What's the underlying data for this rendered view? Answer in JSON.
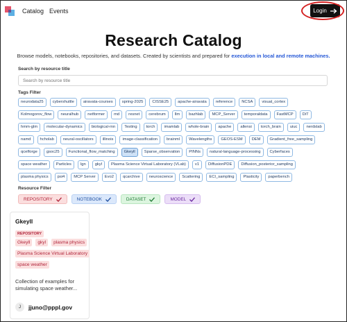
{
  "nav": {
    "links": [
      "Catalog",
      "Events"
    ],
    "login_label": "Login",
    "login_icon": "arrow-right-icon"
  },
  "hero": {
    "title": "Research Catalog",
    "subtitle_text": "Browse models, notebooks, repositories, and datasets. Created by scientists and prepared for ",
    "subtitle_link": "execution in local and remote machines."
  },
  "search": {
    "label": "Search by resource title",
    "placeholder": "Search by resource title"
  },
  "tags_filter": {
    "label": "Tags Filter",
    "selected": "Gkeyll",
    "tags": [
      "neurodata25",
      "cybershuttle",
      "airavata-courses",
      "spring-2025",
      "CISSE25",
      "apache-airavata",
      "reference",
      "NCSA",
      "visual_cortex",
      "Kolmogorov_flow",
      "neuralhub",
      "netformer",
      "md",
      "resnet",
      "cerebrum",
      "llm",
      "bazhlab",
      "MCP_Server",
      "temporaldata",
      "FastMCP",
      "DiT",
      "hmm-glm",
      "molecular-dynamics",
      "biological-rnn",
      "Testing",
      "torch",
      "imamlab",
      "whole-brain",
      "apache",
      "allensi",
      "torch_brain",
      "uiuc",
      "nerdslab",
      "namd",
      "hcholab",
      "neural-oscillators",
      "illinois",
      "image-classification",
      "brainml",
      "Wavelengths",
      "GEOS-ESM",
      "DEM",
      "Gradient_free_sampling",
      "qcelforge",
      "gsoc25",
      "Functional_flow_matching",
      "Gkeyll",
      "Sparse_observation",
      "PINNs",
      "natural-language-processing",
      "Cyberfaces",
      "space weather",
      "Particles",
      "lgn",
      "gkyl",
      "Plasma Science Virtual Laboratory (VLab)",
      "v1",
      "DiffusionPDE",
      "Diffusion_posterior_sampling",
      "plasma physics",
      "psi4",
      "MCP Server",
      "Evo2",
      "qcarchive",
      "neuroscience",
      "Scattering",
      "ECI_sampling",
      "Plasticity",
      "paperbench"
    ]
  },
  "resource_filter": {
    "label": "Resource Filter",
    "items": [
      {
        "label": "REPOSITORY",
        "icon": "check-icon"
      },
      {
        "label": "NOTEBOOK",
        "icon": "check-icon"
      },
      {
        "label": "DATASET",
        "icon": "check-icon"
      },
      {
        "label": "MODEL",
        "icon": "check-icon"
      }
    ]
  },
  "card": {
    "title": "Gkeyll",
    "resource_type": "REPOSITORY",
    "tags": [
      "Gkeyll",
      "gkyl",
      "plasma physics",
      "Plasma Science Virtual Laboratory",
      "space weather"
    ],
    "description": "Collection of examples for simulating space weather...",
    "author_initial": "J",
    "author_email": "jjuno@pppl.gov"
  }
}
